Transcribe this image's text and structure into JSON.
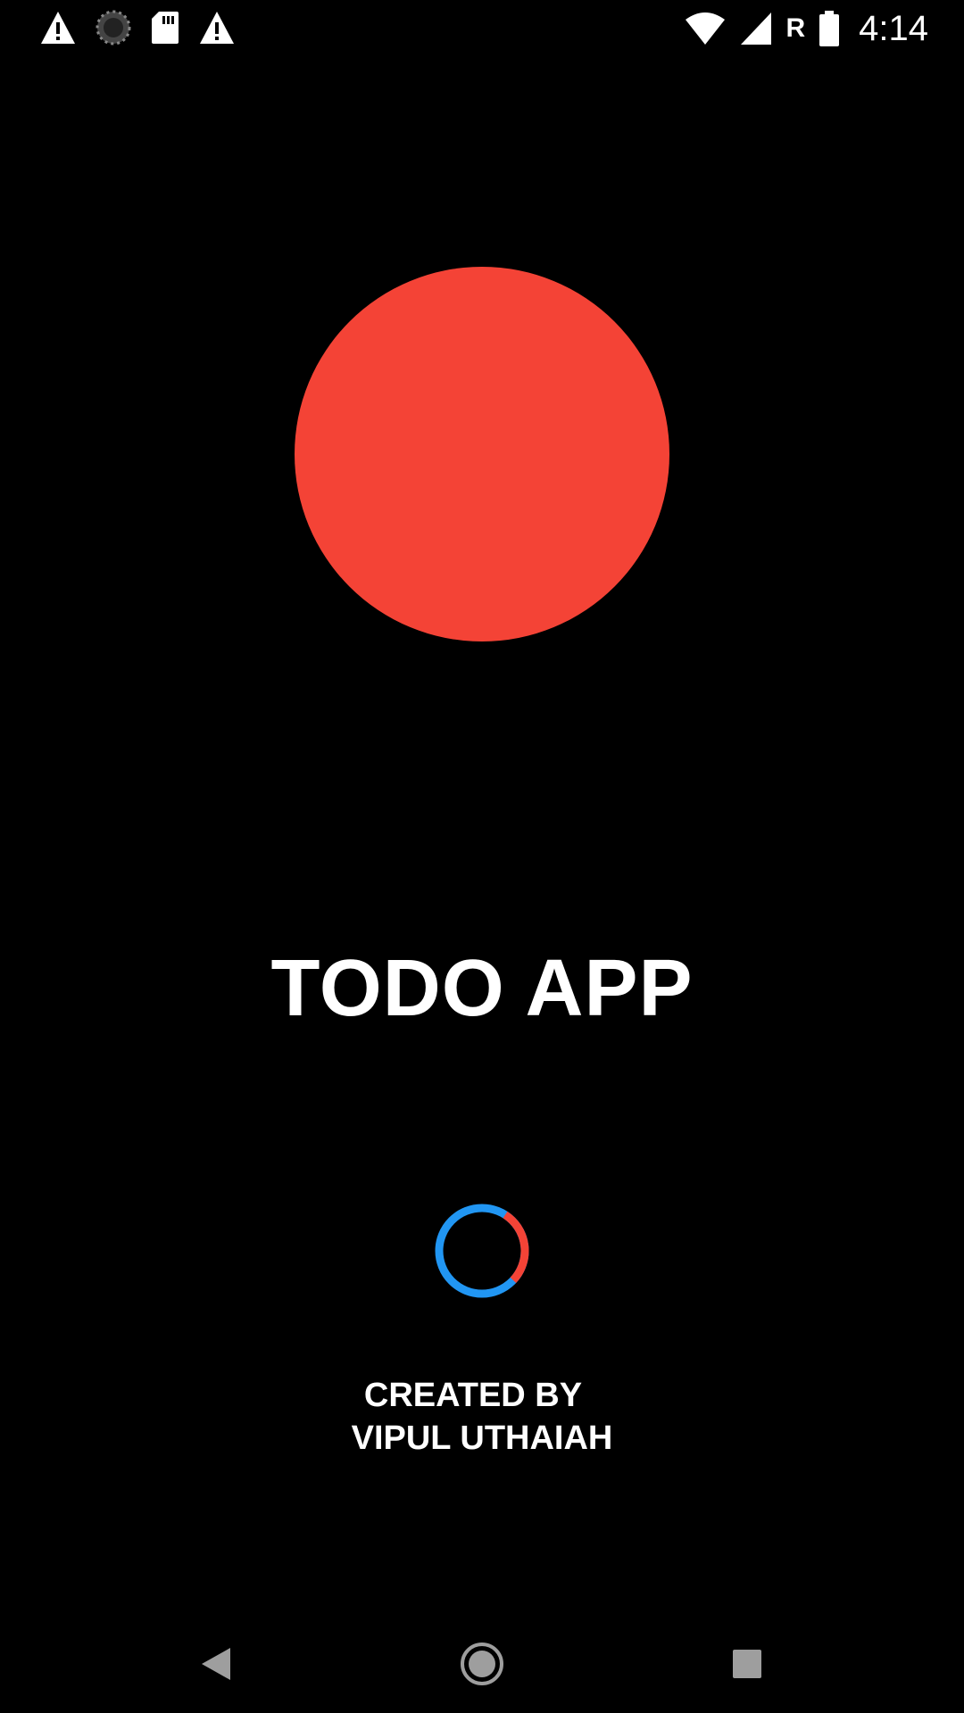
{
  "status_bar": {
    "left_icons": [
      "warning-icon",
      "loading-icon",
      "sd-card-icon",
      "warning-icon"
    ],
    "right_icons": [
      "wifi-icon",
      "cell-signal-icon",
      "battery-icon"
    ],
    "roaming_indicator": "R",
    "time": "4:14"
  },
  "splash": {
    "logo_color": "#F44336",
    "title": "TODO APP",
    "spinner": {
      "primary_color": "#2196F3",
      "accent_color": "#F44336"
    },
    "credit_line1": "CREATED BY",
    "credit_line2": "VIPUL UTHAIAH"
  },
  "nav_bar": {
    "buttons": [
      "back-icon",
      "home-icon",
      "recents-icon"
    ]
  }
}
